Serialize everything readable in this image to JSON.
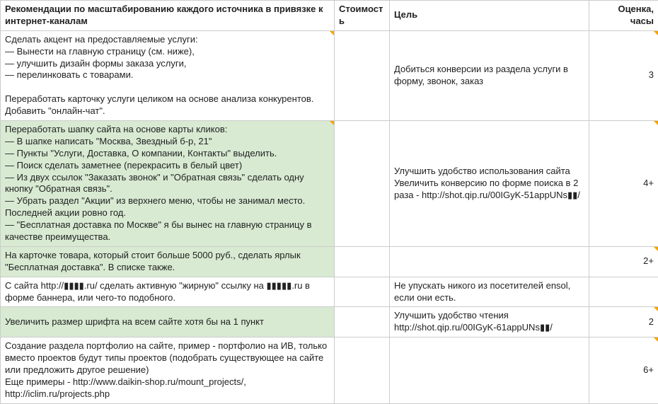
{
  "headers": {
    "rec": "Рекомендации по масштабированию каждого источника в привязке к интернет-каналам",
    "cost": "Стоимость",
    "goal": "Цель",
    "est": "Оценка, часы"
  },
  "rows": [
    {
      "green": false,
      "rec": "Сделать акцент на предоставляемые услуги:\n— Вынести на главную страницу (см. ниже),\n— улучшить дизайн формы заказа услуги,\n— перелинковать с товарами.\n\nПереработать карточку услуги целиком на основе анализа конкурентов.\nДобавить \"онлайн-чат\".",
      "cost": "",
      "goal": "Добиться конверсии из раздела услуги в форму, звонок, заказ",
      "est": "3",
      "mark_rec": true,
      "mark_est": true
    },
    {
      "green": true,
      "rec": "Переработать шапку сайта на основе карты кликов:\n— В шапке написать \"Москва, Звездный б-р, 21\"\n— Пункты \"Услуги, Доставка, О компании, Контакты\" выделить.\n— Поиск сделать заметнее (перекрасить в белый цвет)\n— Из двух ссылок \"Заказать звонок\" и \"Обратная связь\" сделать одну кнопку \"Обратная связь\".\n— Убрать раздел \"Акции\" из верхнего меню, чтобы не занимал место. Последней акции ровно год.\n— \"Бесплатная доставка по Москве\" я бы вынес на главную страницу в качестве преимущества.",
      "cost": "",
      "goal": "Улучшить удобство использования сайта\nУвеличить конверсию по форме поиска в 2 раза - http://shot.qip.ru/00IGyK-51appUNs▮▮/",
      "est": "4+",
      "mark_rec": true,
      "mark_est": true
    },
    {
      "green": true,
      "rec": "На карточке товара, который стоит больше 5000 руб., сделать ярлык \"Бесплатная доставка\". В списке также.",
      "cost": "",
      "goal": "",
      "est": "2+",
      "mark_est": true
    },
    {
      "green": false,
      "rec": "С сайта http://▮▮▮▮.ru/ сделать активную \"жирную\" ссылку на ▮▮▮▮▮.ru в форме баннера, или чего-то подобного.",
      "cost": "",
      "goal": "Не упускать никого из посетителей ensol, если они есть.",
      "est": ""
    },
    {
      "green": true,
      "rec": "Увеличить размер шрифта на всем сайте хотя бы на 1 пункт",
      "cost": "",
      "goal": "Улучшить удобство чтения http://shot.qip.ru/00IGyK-61appUNs▮▮/",
      "est": "2",
      "mark_est": true
    },
    {
      "green": false,
      "rec": "Создание раздела портфолио на сайте, пример - портфолио на ИВ, только вместо проектов будут типы проектов (подобрать существующее на сайте или предложить другое решение)\nЕще примеры - http://www.daikin-shop.ru/mount_projects/, http://iclim.ru/projects.php",
      "cost": "",
      "goal": "",
      "est": "6+",
      "mark_est": true
    }
  ]
}
